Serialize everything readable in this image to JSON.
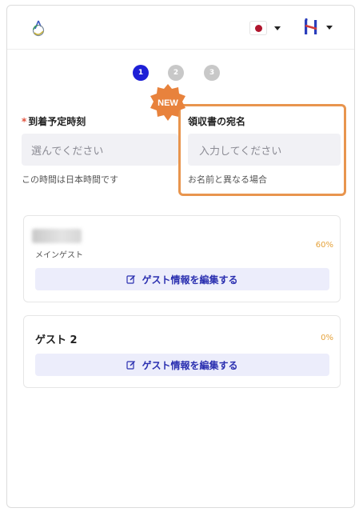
{
  "header": {
    "flag": "jp-flag",
    "brand_logo": "h-logo"
  },
  "steps": [
    "1",
    "2",
    "3"
  ],
  "active_step": 1,
  "badge_text": "NEW",
  "arrival": {
    "required_mark": "*",
    "label": "到着予定時刻",
    "placeholder": "選んでください",
    "hint": "この時間は日本時間です"
  },
  "receipt": {
    "label": "領収書の宛名",
    "placeholder": "入力してください",
    "hint": "お名前と異なる場合"
  },
  "guests": [
    {
      "name": "",
      "role": "メインゲスト",
      "progress": "60%",
      "edit_label": "ゲスト情報を編集する"
    },
    {
      "name": "ゲスト 2",
      "progress": "0%",
      "edit_label": "ゲスト情報を編集する"
    }
  ],
  "colors": {
    "accent": "#1d1fd6",
    "highlight": "#e8954e",
    "progress_text": "#e5a23a",
    "required": "#e0513c"
  }
}
